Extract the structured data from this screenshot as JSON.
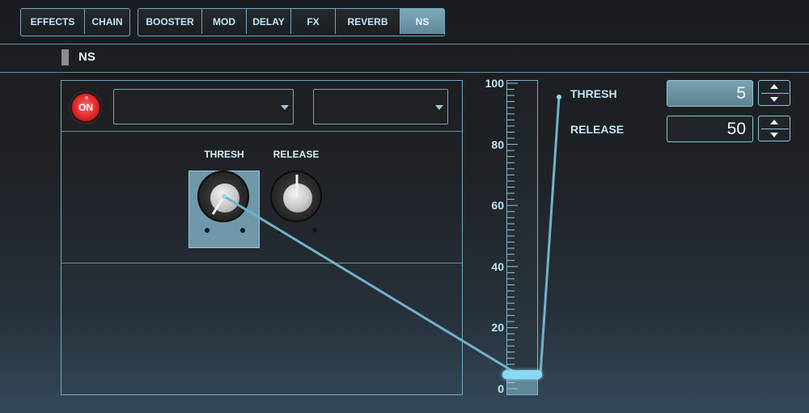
{
  "top_tabs": {
    "group1": [
      {
        "label": "EFFECTS",
        "active": false
      },
      {
        "label": "CHAIN",
        "active": false
      }
    ],
    "group2": [
      {
        "label": "BOOSTER",
        "active": false
      },
      {
        "label": "MOD",
        "active": false
      },
      {
        "label": "DELAY",
        "active": false
      },
      {
        "label": "FX",
        "active": false
      },
      {
        "label": "REVERB",
        "active": false
      },
      {
        "label": "NS",
        "active": true
      }
    ]
  },
  "section": {
    "title": "NS"
  },
  "effect": {
    "on_label": "ON",
    "type_select": {
      "value": ""
    },
    "variation_select": {
      "value": ""
    }
  },
  "knobs": {
    "thresh": {
      "label": "THRESH",
      "value": 5,
      "selected": true
    },
    "release": {
      "label": "RELEASE",
      "value": 50,
      "selected": false
    }
  },
  "slider": {
    "ticks": [
      "100",
      "80",
      "60",
      "40",
      "20",
      "0"
    ],
    "min": 0,
    "max": 100,
    "value": 5
  },
  "params": [
    {
      "label": "THRESH",
      "value": "5",
      "active": true
    },
    {
      "label": "RELEASE",
      "value": "50",
      "active": false
    }
  ],
  "colors": {
    "accent": "#8ad8f5",
    "border": "#6fa9bf",
    "on_red": "#e02828",
    "selected_bg": "#6f98aa"
  },
  "icons": {
    "dropdown": "chevron-down-icon",
    "step_up": "arrow-up-icon",
    "step_down": "arrow-down-icon"
  }
}
